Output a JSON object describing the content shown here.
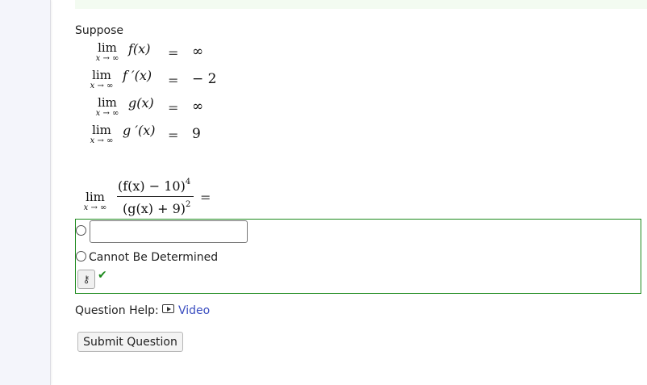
{
  "intro": "Suppose",
  "limits": [
    {
      "lim": "lim",
      "sub": "x → ∞",
      "fn": "f(x)",
      "eq": "=",
      "value": "∞"
    },
    {
      "lim": "lim",
      "sub": "x → ∞",
      "fn": "f ′(x)",
      "eq": "=",
      "value": "− 2"
    },
    {
      "lim": "lim",
      "sub": "x → ∞",
      "fn": "g(x)",
      "eq": "=",
      "value": "∞"
    },
    {
      "lim": "lim",
      "sub": "x → ∞",
      "fn": "g ′(x)",
      "eq": "=",
      "value": "9"
    }
  ],
  "question": {
    "lim": "lim",
    "sub": "x → ∞",
    "numerator_base": "(f(x) − 10)",
    "numerator_exp": "4",
    "denominator_base": "(g(x) + 9)",
    "denominator_exp": "2",
    "eq": "="
  },
  "answer": {
    "input_value": "",
    "option_cbd": "Cannot Be Determined"
  },
  "icons": {
    "key": "key-icon",
    "check": "checkmark-icon",
    "video": "video-icon"
  },
  "help": {
    "label": "Question Help:",
    "video_link": "Video"
  },
  "submit_label": "Submit Question",
  "colors": {
    "correct_border": "#1d8a1d",
    "link": "#3a4dc0",
    "top_band": "#f3fbf1"
  }
}
